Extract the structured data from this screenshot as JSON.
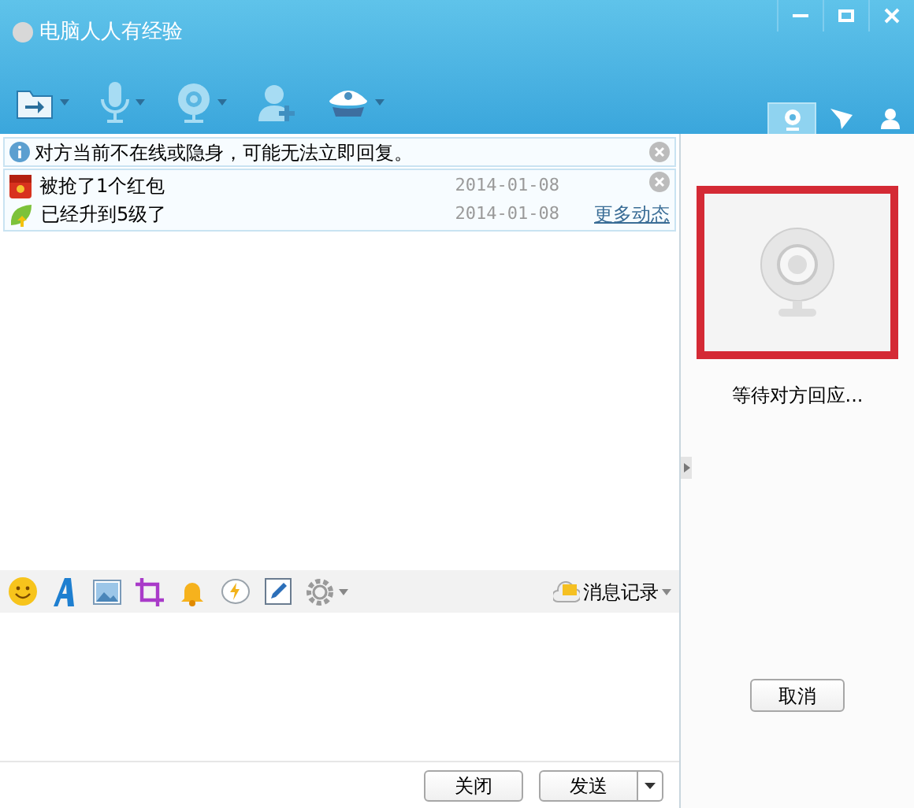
{
  "window": {
    "title": "电脑人人有经验"
  },
  "toolbar": [
    {
      "kind": "file",
      "dropdown": true
    },
    {
      "kind": "mic",
      "dropdown": true
    },
    {
      "kind": "camera",
      "dropdown": true
    },
    {
      "kind": "add-contact",
      "dropdown": false
    },
    {
      "kind": "hat",
      "dropdown": true
    }
  ],
  "side_tabs": [
    {
      "kind": "camera",
      "selected": true
    },
    {
      "kind": "send",
      "selected": false
    },
    {
      "kind": "person",
      "selected": false
    }
  ],
  "notice": {
    "text": "对方当前不在线或隐身，可能无法立即回复。"
  },
  "feed": [
    {
      "kind": "redpacket",
      "text": "被抢了1个红包",
      "date": "2014-01-08"
    },
    {
      "kind": "levelup",
      "text": "已经升到5级了",
      "date": "2014-01-08",
      "link": "更多动态"
    }
  ],
  "history_button": {
    "label": "消息记录"
  },
  "buttons": {
    "close": "关闭",
    "send": "发送"
  },
  "video": {
    "status": "等待对方回应...",
    "cancel": "取消"
  }
}
